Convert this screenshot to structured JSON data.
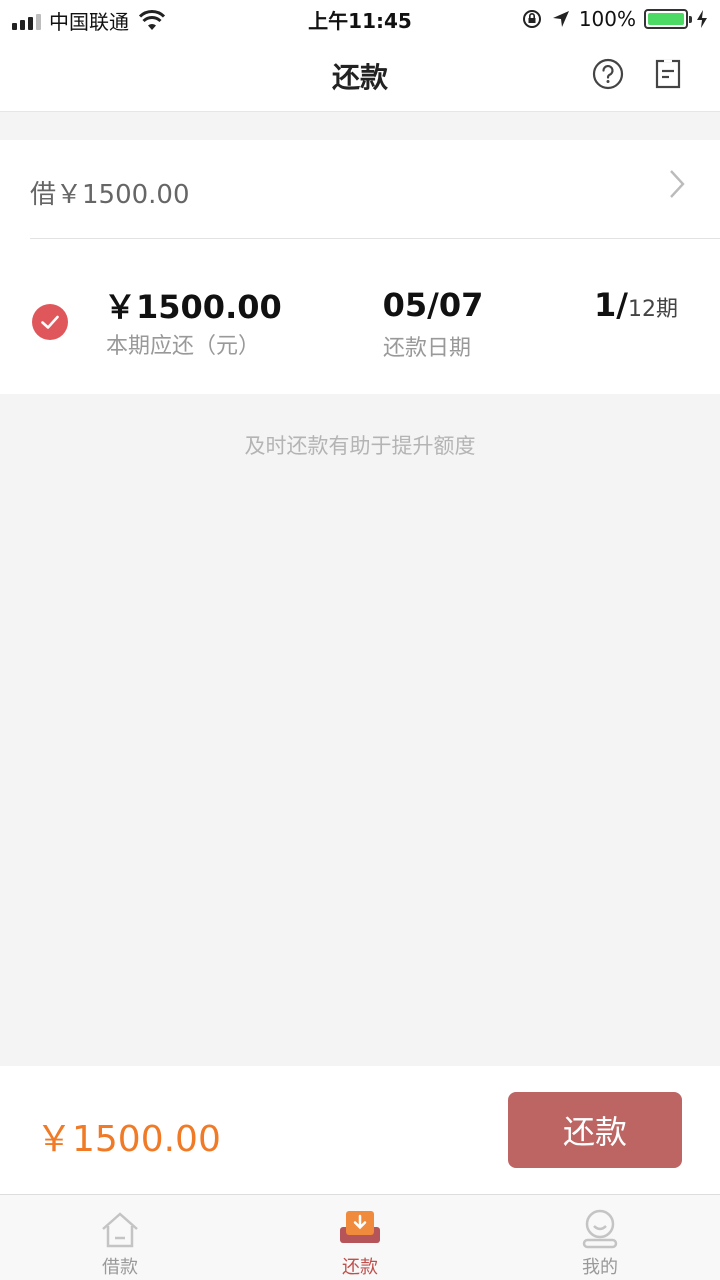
{
  "status_bar": {
    "carrier": "中国联通",
    "time": "上午11:45",
    "battery": "100%"
  },
  "nav": {
    "title": "还款",
    "icons": [
      "help-icon",
      "bill-icon"
    ]
  },
  "loan": {
    "title": "借￥1500.00",
    "amount": "￥1500.00",
    "amount_label": "本期应还（元）",
    "date": "05/07",
    "date_label": "还款日期",
    "period_current": "1/",
    "period_total": "12期"
  },
  "tip": "及时还款有助于提升额度",
  "pay": {
    "total": "￥1500.00",
    "button": "还款"
  },
  "tabs": [
    {
      "label": "借款",
      "icon": "house-icon"
    },
    {
      "label": "还款",
      "icon": "repay-icon",
      "active": true
    },
    {
      "label": "我的",
      "icon": "profile-icon"
    }
  ],
  "colors": {
    "accent": "#bc6563",
    "total": "#f07a26",
    "check": "#e0575b",
    "active_tab": "#c0504d"
  }
}
